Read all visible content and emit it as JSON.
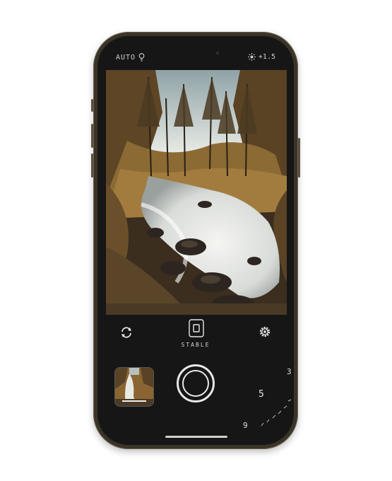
{
  "status_bar": {
    "flash_mode": "AUTO",
    "flash_icon": "lightbulb-icon",
    "exposure_icon": "sun-icon",
    "exposure_value": "+1.5"
  },
  "controls": {
    "switch_camera_icon": "switch-camera-icon",
    "stabilization_icon": "stabilization-icon",
    "stabilization_label": "STABLE",
    "settings_icon": "gear-icon"
  },
  "capture": {
    "thumbnail_label": "last-photo-thumbnail",
    "shutter_label": "shutter-button",
    "dial_values": [
      "3",
      "5",
      "9"
    ]
  },
  "colors": {
    "phone_body": "#3a3328",
    "screen_bg": "#161616",
    "ui_text": "#e6e6e6"
  }
}
